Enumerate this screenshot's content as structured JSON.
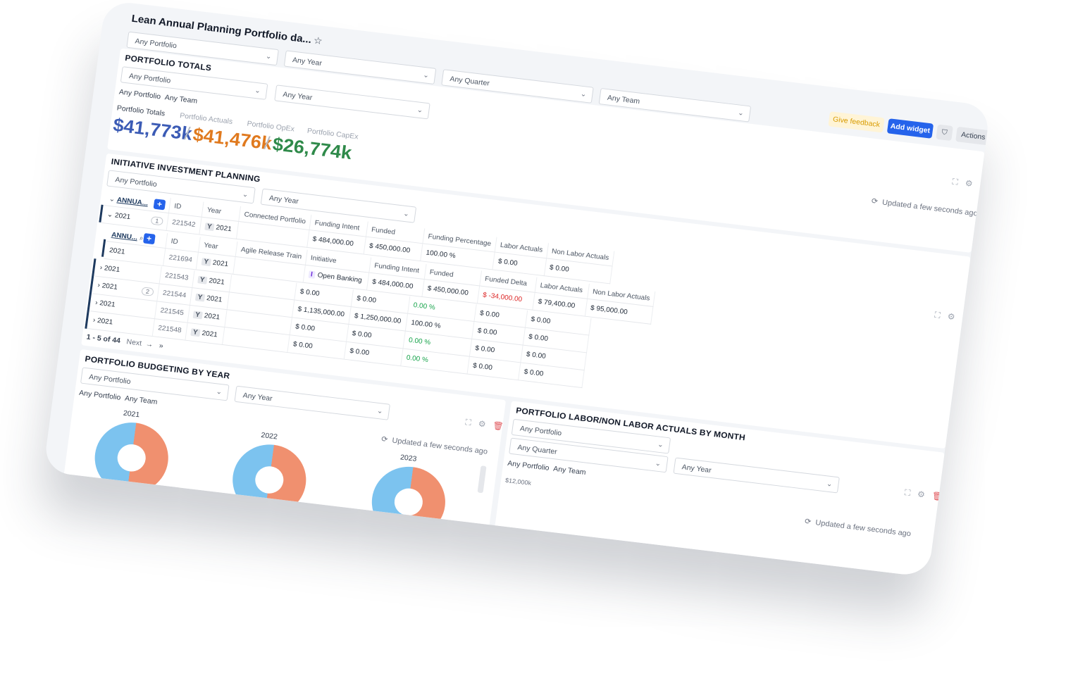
{
  "header": {
    "title": "Lean Annual Planning Portfolio da...",
    "filters": [
      "Any Portfolio",
      "Any Year",
      "Any Quarter",
      "Any Team"
    ],
    "give_feedback": "Give feedback",
    "add_widget": "Add widget",
    "actions": "Actions"
  },
  "portfolio_totals": {
    "title": "PORTFOLIO TOTALS",
    "filters": [
      "Any Portfolio",
      "Any Year"
    ],
    "tags": [
      "Any Portfolio",
      "Any Team"
    ],
    "labels": [
      "Portfolio Totals",
      "Portfolio Actuals",
      "Portfolio OpEx",
      "Portfolio CapEx"
    ],
    "values": [
      "$41,773k",
      "$41,476k",
      "$26,774k"
    ],
    "separator": "/",
    "updated": "Updated a few seconds ago",
    "colors": {
      "totals": "#3b5bb5",
      "actuals": "#e07a1f",
      "opex": "#2f8a4a"
    }
  },
  "investment": {
    "title": "INITIATIVE INVESTMENT PLANNING",
    "filters": [
      "Any Portfolio",
      "Any Year"
    ],
    "outer_headers": [
      "ANNUA...",
      "ID",
      "Year",
      "Connected Portfolio",
      "Funding Intent",
      "Funded",
      "Funding Percentage",
      "Labor Actuals",
      "Non Labor Actuals"
    ],
    "outer_row": {
      "group": "2021",
      "count": "1",
      "id": "221542",
      "year": "2021",
      "intent": "$ 484,000.00",
      "funded": "$ 450,000.00",
      "pct": "100.00 %",
      "labor": "$ 0.00",
      "nonlabor": "$ 0.00"
    },
    "inner_headers": [
      "ANNU...",
      "ID",
      "Year",
      "Agile Release Train",
      "Initiative",
      "Funding Intent",
      "Funded",
      "Funded Delta",
      "Labor Actuals",
      "Non Labor Actuals"
    ],
    "inner_row": {
      "group": "2021",
      "id": "221694",
      "year": "2021",
      "initiative": "Open Banking",
      "intent": "$ 484,000.00",
      "funded": "$ 450,000.00",
      "delta": "$ -34,000.00",
      "labor": "$ 79,400.00",
      "nonlabor": "$ 95,000.00"
    },
    "rows": [
      {
        "group": "2021",
        "count": "",
        "id": "221543",
        "year": "2021",
        "intent": "$ 0.00",
        "funded": "$ 0.00",
        "pct": "0.00 %",
        "labor": "$ 0.00",
        "nonlabor": "$ 0.00"
      },
      {
        "group": "2021",
        "count": "2",
        "id": "221544",
        "year": "2021",
        "intent": "$ 1,135,000.00",
        "funded": "$ 1,250,000.00",
        "pct": "100.00 %",
        "labor": "$ 0.00",
        "nonlabor": "$ 0.00"
      },
      {
        "group": "2021",
        "count": "",
        "id": "221545",
        "year": "2021",
        "intent": "$ 0.00",
        "funded": "$ 0.00",
        "pct": "0.00 %",
        "labor": "$ 0.00",
        "nonlabor": "$ 0.00"
      },
      {
        "group": "2021",
        "count": "",
        "id": "221548",
        "year": "2021",
        "intent": "$ 0.00",
        "funded": "$ 0.00",
        "pct": "0.00 %",
        "labor": "$ 0.00",
        "nonlabor": "$ 0.00"
      }
    ],
    "pagination": {
      "range": "1 - 5 of 44",
      "next": "Next"
    },
    "year_badge": "Y",
    "initiative_badge": "I"
  },
  "budgeting": {
    "title": "PORTFOLIO BUDGETING BY YEAR",
    "filters": [
      "Any Portfolio",
      "Any Year"
    ],
    "tags": [
      "Any Portfolio",
      "Any Team"
    ],
    "updated": "Updated a few seconds ago",
    "years": [
      "2021",
      "2022",
      "2023"
    ]
  },
  "labor": {
    "title": "PORTFOLIO LABOR/NON LABOR ACTUALS BY MONTH",
    "filters": [
      "Any Portfolio",
      "Any Quarter",
      "Any Year"
    ],
    "tags": [
      "Any Portfolio",
      "Any Team"
    ],
    "axis_top": "$12,000k",
    "updated": "Updated a few seconds ago"
  }
}
